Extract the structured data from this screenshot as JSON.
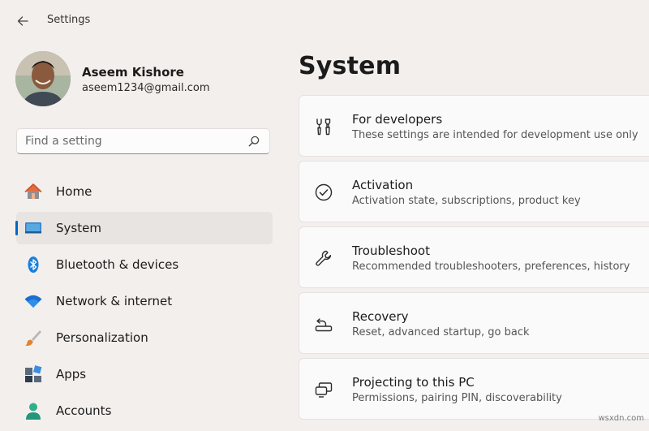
{
  "window": {
    "title": "Settings"
  },
  "user": {
    "name": "Aseem Kishore",
    "email": "aseem1234@gmail.com"
  },
  "search": {
    "placeholder": "Find a setting",
    "value": ""
  },
  "sidebar": {
    "items": [
      {
        "label": "Home",
        "icon": "home-icon"
      },
      {
        "label": "System",
        "icon": "system-icon",
        "selected": true
      },
      {
        "label": "Bluetooth & devices",
        "icon": "bluetooth-icon"
      },
      {
        "label": "Network & internet",
        "icon": "wifi-icon"
      },
      {
        "label": "Personalization",
        "icon": "brush-icon"
      },
      {
        "label": "Apps",
        "icon": "apps-icon"
      },
      {
        "label": "Accounts",
        "icon": "accounts-icon"
      }
    ]
  },
  "main": {
    "title": "System",
    "cards": [
      {
        "title": "For developers",
        "desc": "These settings are intended for development use only",
        "icon": "developer-tools-icon"
      },
      {
        "title": "Activation",
        "desc": "Activation state, subscriptions, product key",
        "icon": "check-circle-icon"
      },
      {
        "title": "Troubleshoot",
        "desc": "Recommended troubleshooters, preferences, history",
        "icon": "wrench-icon"
      },
      {
        "title": "Recovery",
        "desc": "Reset, advanced startup, go back",
        "icon": "recovery-icon"
      },
      {
        "title": "Projecting to this PC",
        "desc": "Permissions, pairing PIN, discoverability",
        "icon": "projecting-icon"
      }
    ]
  },
  "watermark": "wsxdn.com",
  "colors": {
    "accent": "#0067c0",
    "background": "#f3efed",
    "card": "#fbfafa"
  }
}
